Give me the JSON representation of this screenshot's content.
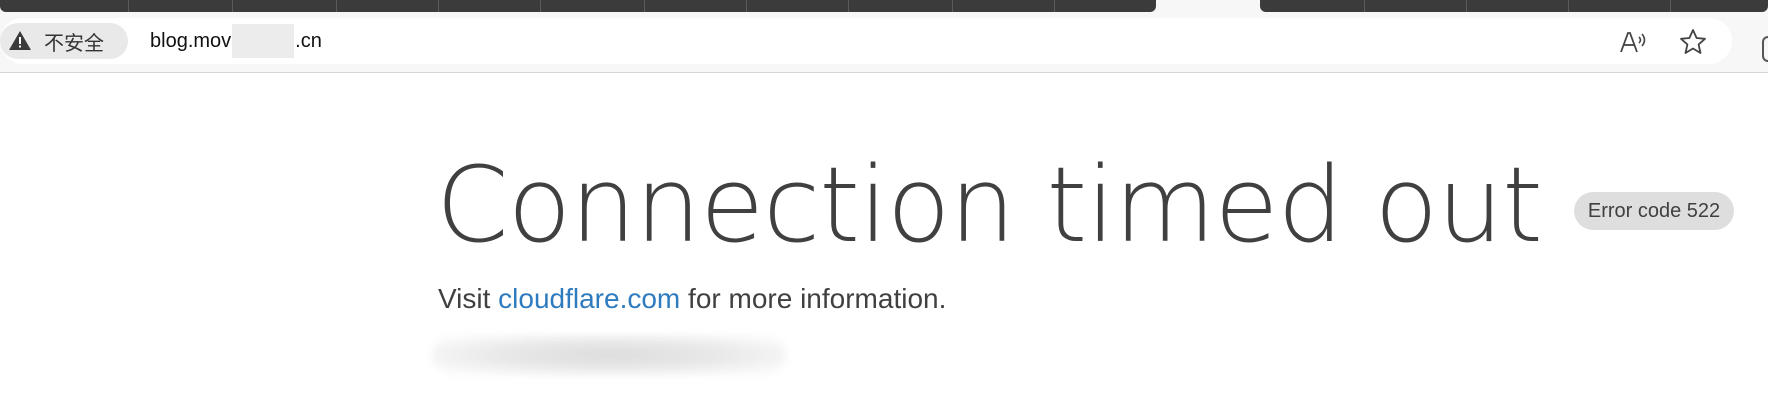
{
  "browser": {
    "security_label": "不安全",
    "url_prefix": "blog.mov",
    "url_suffix": ".cn",
    "icons": {
      "security": "warning-triangle-icon",
      "read_aloud": "read-aloud-icon",
      "favorite": "star-icon"
    }
  },
  "page": {
    "headline": "Connection timed out",
    "error_badge": "Error code 522",
    "visit_prefix": "Visit ",
    "visit_link": "cloudflare.com",
    "visit_suffix": " for more information."
  },
  "colors": {
    "link": "#2f7bbf",
    "text": "#404040",
    "badge_bg": "#dedede",
    "tab_dark": "#3b3b3b"
  }
}
